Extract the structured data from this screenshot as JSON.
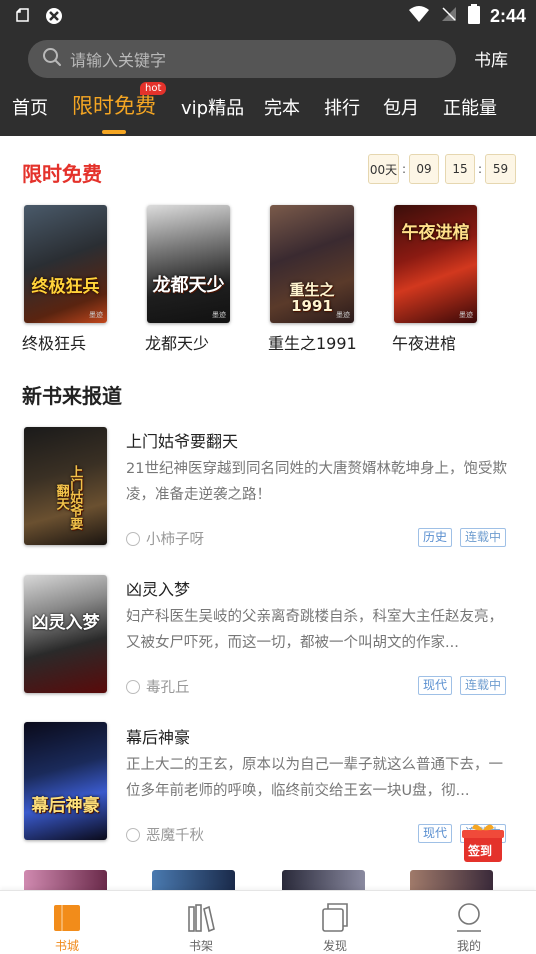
{
  "status": {
    "time": "2:44"
  },
  "search": {
    "placeholder": "请输入关键字",
    "library_label": "书库"
  },
  "tabs": [
    {
      "label": "首页"
    },
    {
      "label": "限时免费",
      "badge": "hot"
    },
    {
      "label": "vip精品"
    },
    {
      "label": "完本"
    },
    {
      "label": "排行"
    },
    {
      "label": "包月"
    },
    {
      "label": "正能量"
    }
  ],
  "free": {
    "title": "限时免费",
    "countdown": {
      "days": "00天",
      "hours": "09",
      "minutes": "15",
      "seconds": "59"
    },
    "books": [
      {
        "name": "终极狂兵",
        "cover_text": "终极狂兵",
        "brand": "墨迹"
      },
      {
        "name": "龙都天少",
        "cover_text": "龙都天少",
        "brand": "墨迹"
      },
      {
        "name": "重生之1991",
        "cover_text": "重生之1991",
        "brand": "墨迹"
      },
      {
        "name": "午夜进棺",
        "cover_text": "午夜进棺",
        "brand": "墨迹"
      }
    ]
  },
  "newbooks": {
    "title": "新书来报道",
    "items": [
      {
        "title": "上门姑爷要翻天",
        "desc": "21世纪神医穿越到同名同姓的大唐赘婿林乾坤身上，饱受欺凌，准备走逆袭之路！",
        "author": "小柿子呀",
        "genre": "历史",
        "status": "连载中",
        "cover_text": "上门姑爷要翻天"
      },
      {
        "title": "凶灵入梦",
        "desc": "妇产科医生吴岐的父亲离奇跳楼自杀，科室大主任赵友亮，又被女尸吓死，而这一切，都被一个叫胡文的作家...",
        "author": "毒孔丘",
        "genre": "现代",
        "status": "连载中",
        "cover_text": "凶灵入梦"
      },
      {
        "title": "幕后神豪",
        "desc": "正上大二的王玄，原本以为自己一辈子就这么普通下去，一位多年前老师的呼唤，临终前交给王玄一块U盘，彻...",
        "author": "恶魔千秋",
        "genre": "现代",
        "status": "连载中",
        "cover_text": "幕后神豪"
      }
    ]
  },
  "signin": {
    "label": "签到"
  },
  "bottom_nav": [
    {
      "label": "书城",
      "icon": "book-city-icon",
      "active": true
    },
    {
      "label": "书架",
      "icon": "bookshelf-icon"
    },
    {
      "label": "发现",
      "icon": "discover-icon"
    },
    {
      "label": "我的",
      "icon": "profile-icon"
    }
  ],
  "colors": {
    "accent": "#f5a623",
    "red": "#e4322b",
    "header_bg": "#2f2f2f",
    "tag_blue": "#5a8fd0"
  }
}
